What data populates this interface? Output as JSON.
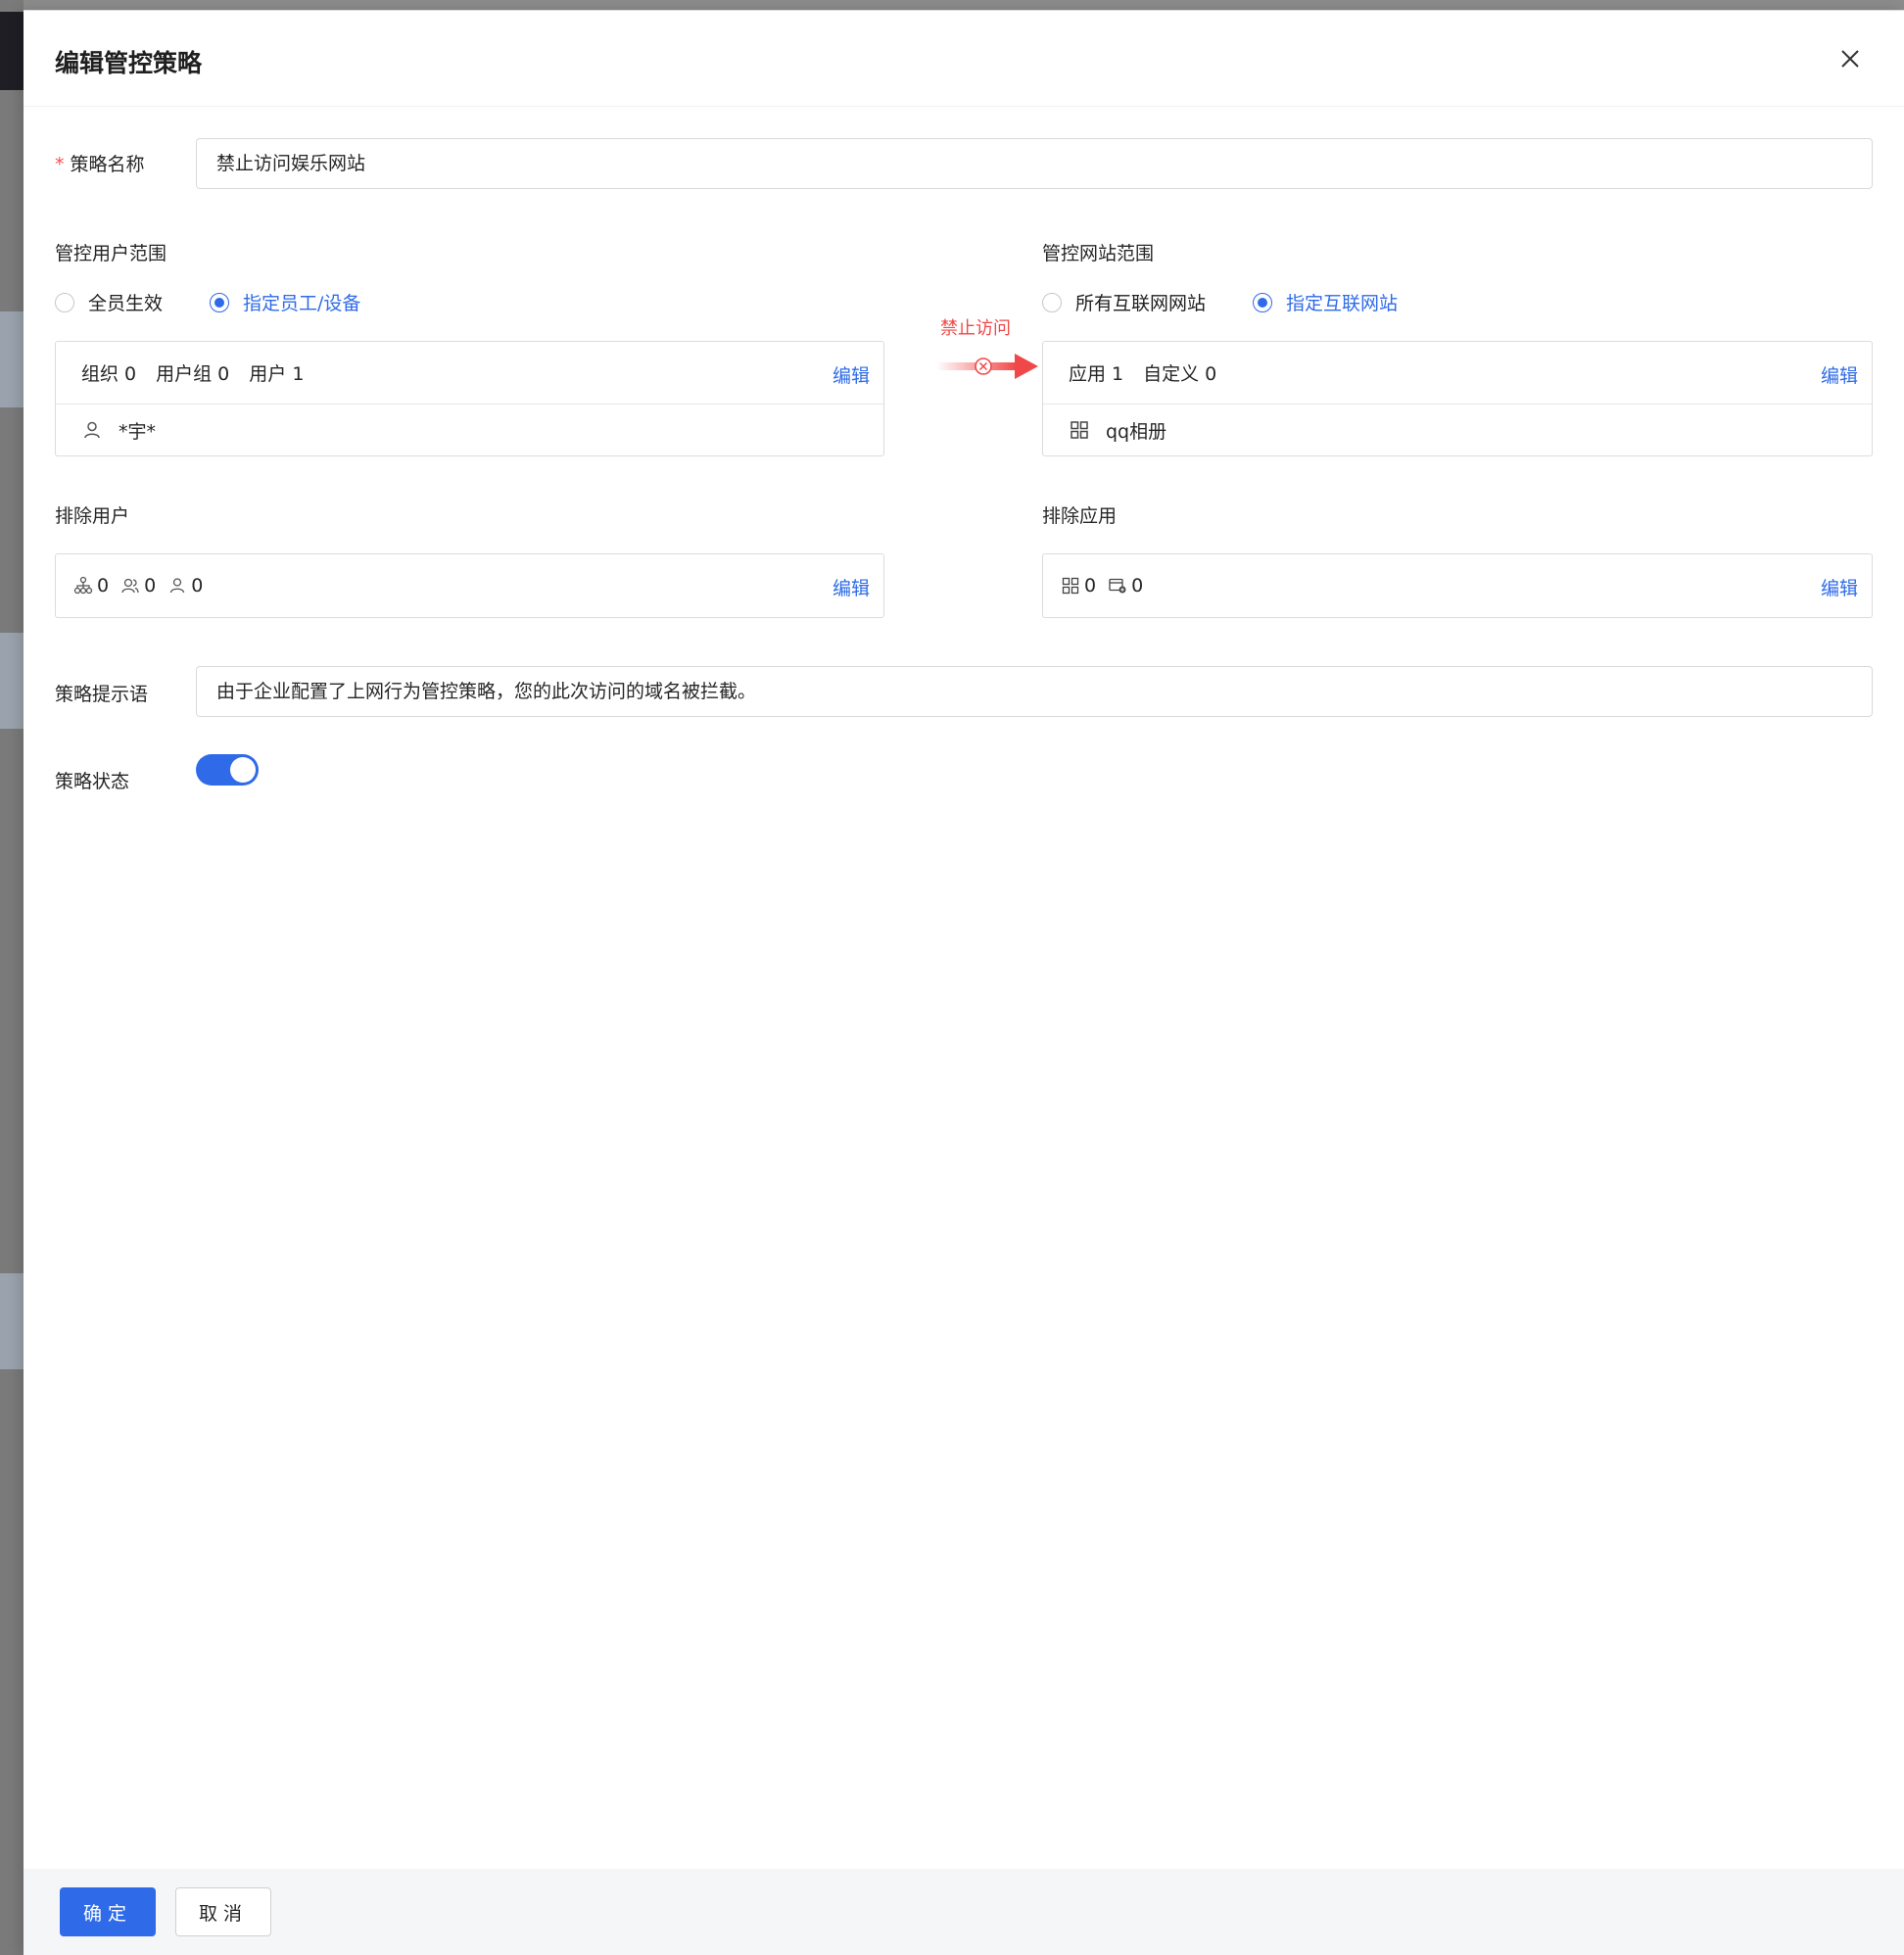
{
  "drawer": {
    "title": "编辑管控策略"
  },
  "form": {
    "policy_name_label": "策略名称",
    "policy_name_required": "*",
    "policy_name_value": "禁止访问娱乐网站",
    "user_scope": {
      "label": "管控用户范围",
      "options": [
        "全员生效",
        "指定员工/设备"
      ],
      "selected": "指定员工/设备",
      "stats": [
        "组织 0",
        "用户组 0",
        "用户 1"
      ],
      "edit_label": "编辑",
      "items": [
        "*宇*"
      ]
    },
    "block_label": "禁止访问",
    "site_scope": {
      "label": "管控网站范围",
      "options": [
        "所有互联网网站",
        "指定互联网站"
      ],
      "selected": "指定互联网站",
      "stats": [
        "应用 1",
        "自定义 0"
      ],
      "edit_label": "编辑",
      "items": [
        "qq相册"
      ]
    },
    "exclude_users": {
      "label": "排除用户",
      "org_count": "0",
      "group_count": "0",
      "user_count": "0",
      "edit_label": "编辑"
    },
    "exclude_apps": {
      "label": "排除应用",
      "app_count": "0",
      "custom_count": "0",
      "edit_label": "编辑"
    },
    "prompt_label": "策略提示语",
    "prompt_value": "由于企业配置了上网行为管控策略，您的此次访问的域名被拦截。",
    "status_label": "策略状态",
    "status_on": true
  },
  "footer": {
    "confirm_label": "确定",
    "cancel_label": "取消"
  },
  "colors": {
    "primary": "#2f6be8",
    "danger": "#f04848",
    "required": "#ff4d4f"
  }
}
